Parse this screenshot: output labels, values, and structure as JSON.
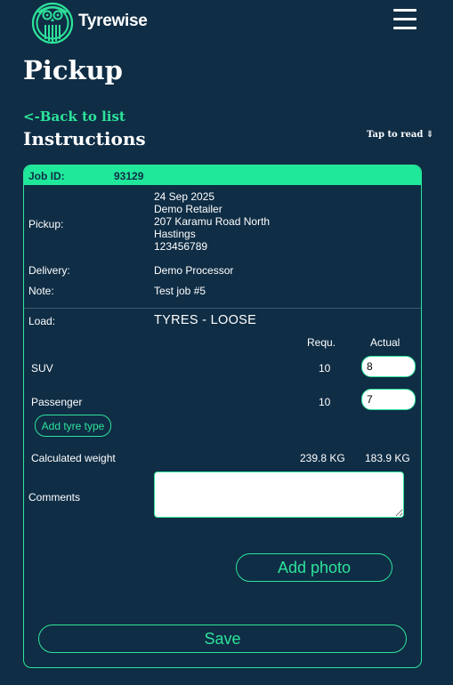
{
  "header": {
    "brand": "Tyrewise",
    "logo_icon": "owl-icon",
    "menu_icon": "hamburger-icon"
  },
  "page": {
    "title": "Pickup",
    "back_link": "<-Back to list",
    "section_title": "Instructions",
    "tap_to_read": "Tap to read ⇓"
  },
  "job": {
    "id_label": "Job ID:",
    "id_value": "93129",
    "pickup_label": "Pickup:",
    "pickup_lines": [
      "24 Sep 2025",
      "Demo Retailer",
      "207 Karamu Road North",
      "Hastings",
      "123456789"
    ],
    "delivery_label": "Delivery:",
    "delivery_value": "Demo Processor",
    "note_label": "Note:",
    "note_value": "Test job #5"
  },
  "load": {
    "label": "Load:",
    "value": "TYRES - LOOSE",
    "col_required": "Requ.",
    "col_actual": "Actual",
    "rows": [
      {
        "type": "SUV",
        "required": "10",
        "actual": "8"
      },
      {
        "type": "Passenger",
        "required": "10",
        "actual": "7"
      }
    ],
    "add_tyre_label": "Add tyre type",
    "weight_label": "Calculated weight",
    "weight_required": "239.8 KG",
    "weight_actual": "183.9 KG"
  },
  "form": {
    "comments_label": "Comments",
    "comments_value": "",
    "add_photo_label": "Add photo",
    "save_label": "Save"
  },
  "colors": {
    "background": "#0f2d45",
    "accent": "#2de39a",
    "job_bar": "#1fe89b",
    "text": "#ffffff"
  }
}
